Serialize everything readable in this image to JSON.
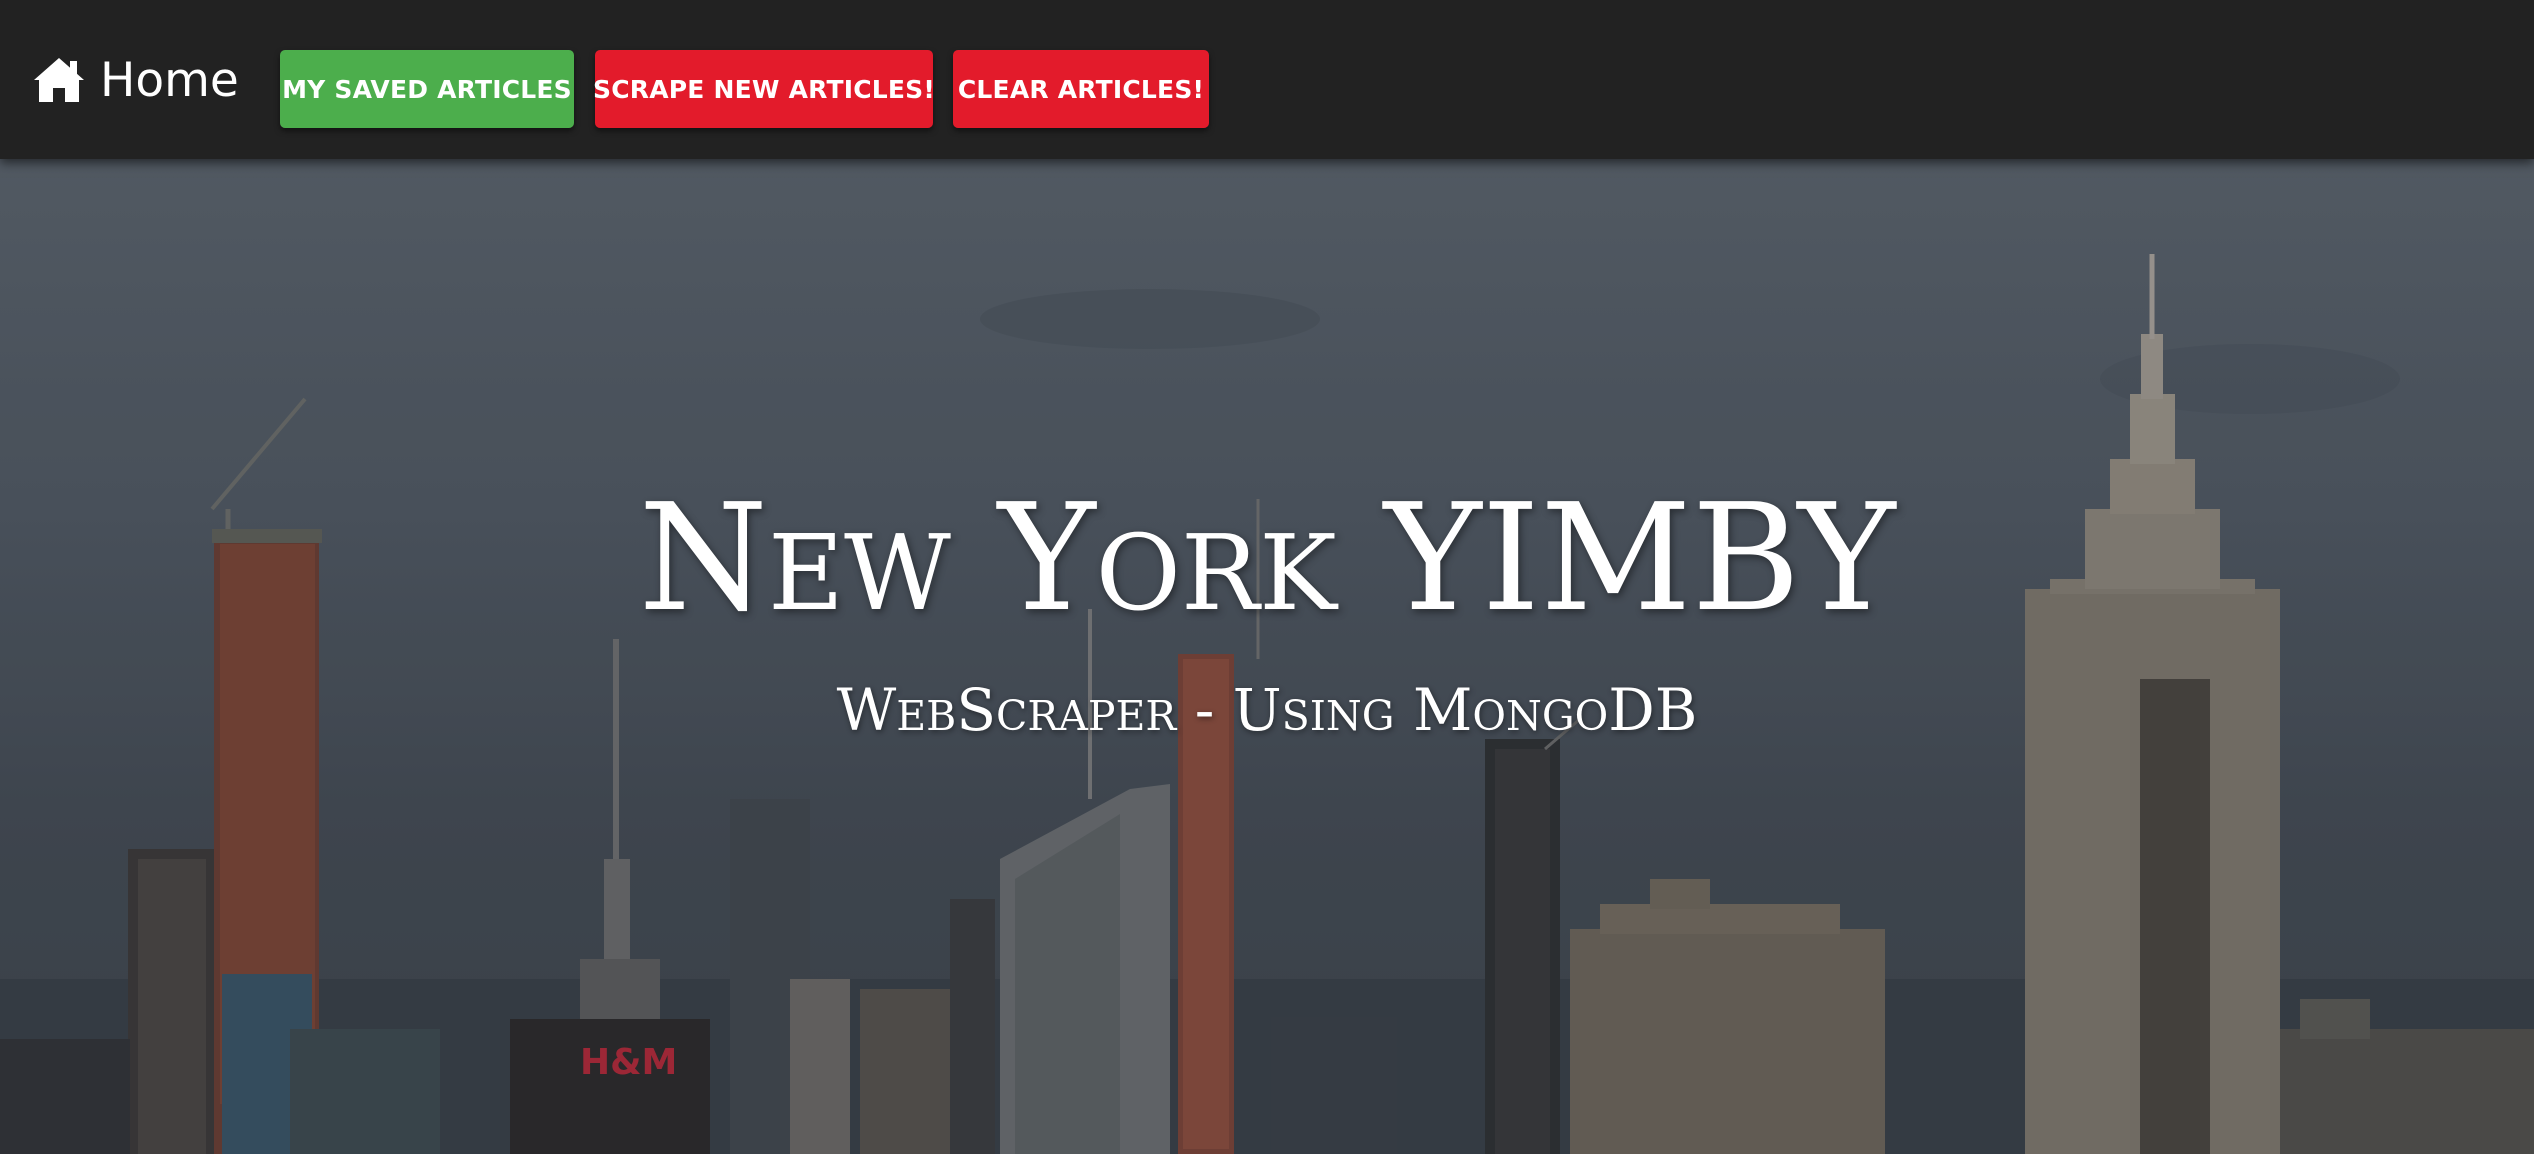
{
  "navbar": {
    "home_label": "Home",
    "home_icon": "home-icon",
    "buttons": [
      {
        "label": "MY SAVED ARTICLES",
        "color": "#4cae4c"
      },
      {
        "label": "SCRAPE NEW ARTICLES!",
        "color": "#e31b2b"
      },
      {
        "label": "CLEAR ARTICLES!",
        "color": "#e31b2b"
      }
    ],
    "background": "#222222"
  },
  "hero": {
    "title": "New York YIMBY",
    "subtitle": "WebScraper - Using MongoDB",
    "background_image": "new-york-skyline"
  }
}
